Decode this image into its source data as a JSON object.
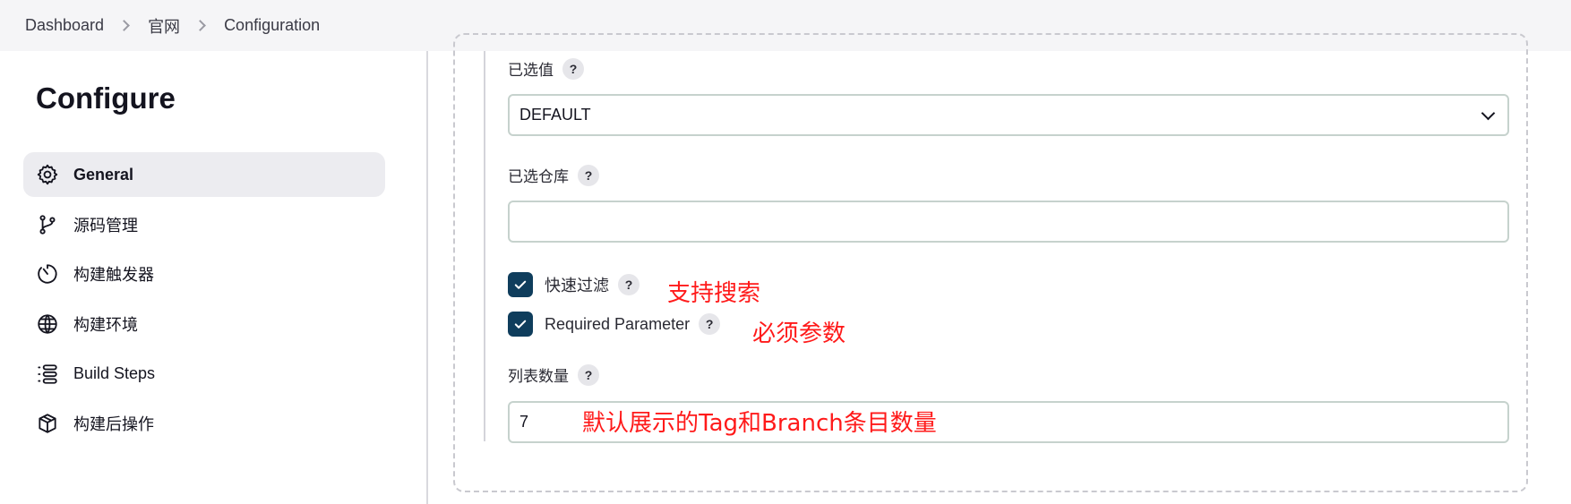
{
  "breadcrumb": [
    "Dashboard",
    "官网",
    "Configuration"
  ],
  "sidebar": {
    "title": "Configure",
    "items": [
      {
        "label": "General",
        "icon": "gear-icon",
        "active": true
      },
      {
        "label": "源码管理",
        "icon": "branch-icon",
        "active": false
      },
      {
        "label": "构建触发器",
        "icon": "timer-icon",
        "active": false
      },
      {
        "label": "构建环境",
        "icon": "globe-icon",
        "active": false
      },
      {
        "label": "Build Steps",
        "icon": "list-icon",
        "active": false
      },
      {
        "label": "构建后操作",
        "icon": "package-icon",
        "active": false
      }
    ]
  },
  "form": {
    "selected_value": {
      "label": "已选值",
      "help": "?",
      "value": "DEFAULT"
    },
    "selected_repo": {
      "label": "已选仓库",
      "help": "?",
      "value": ""
    },
    "quick_filter": {
      "label": "快速过滤",
      "help": "?",
      "checked": true
    },
    "required_param": {
      "label": "Required Parameter",
      "help": "?",
      "checked": true
    },
    "list_count": {
      "label": "列表数量",
      "help": "?",
      "value": "7"
    }
  },
  "annotations": {
    "search": "支持搜索",
    "required": "必须参数",
    "count": "默认展示的Tag和Branch条目数量"
  },
  "colors": {
    "annotation": "#ff1a1a",
    "checkbox": "#0f3d5c",
    "active_nav": "#ececf0"
  }
}
